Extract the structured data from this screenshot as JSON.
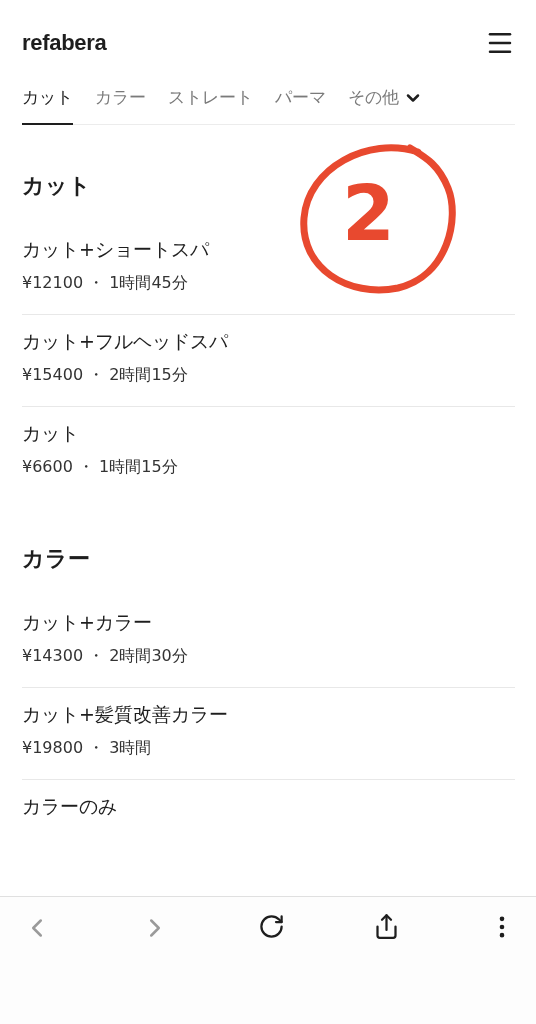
{
  "header": {
    "logo": "refabera"
  },
  "tabs": [
    {
      "label": "カット",
      "selected": true,
      "dropdown": false
    },
    {
      "label": "カラー",
      "selected": false,
      "dropdown": false
    },
    {
      "label": "ストレート",
      "selected": false,
      "dropdown": false
    },
    {
      "label": "パーマ",
      "selected": false,
      "dropdown": false
    },
    {
      "label": "その他",
      "selected": false,
      "dropdown": true
    }
  ],
  "sections": [
    {
      "title": "カット",
      "items": [
        {
          "name": "カット+ショートスパ",
          "meta": "¥12100 ・ 1時間45分"
        },
        {
          "name": "カット+フルヘッドスパ",
          "meta": "¥15400 ・ 2時間15分"
        },
        {
          "name": "カット",
          "meta": "¥6600 ・ 1時間15分"
        }
      ]
    },
    {
      "title": "カラー",
      "items": [
        {
          "name": "カット+カラー",
          "meta": "¥14300 ・ 2時間30分"
        },
        {
          "name": "カット+髪質改善カラー",
          "meta": "¥19800 ・ 3時間"
        },
        {
          "name": "カラーのみ"
        }
      ]
    }
  ],
  "annotation": {
    "label": "2"
  },
  "toolbar": [
    {
      "kind": "back",
      "disabled": true
    },
    {
      "kind": "forward",
      "disabled": true
    },
    {
      "kind": "reload",
      "disabled": false
    },
    {
      "kind": "share",
      "disabled": false
    },
    {
      "kind": "more",
      "disabled": false
    }
  ]
}
